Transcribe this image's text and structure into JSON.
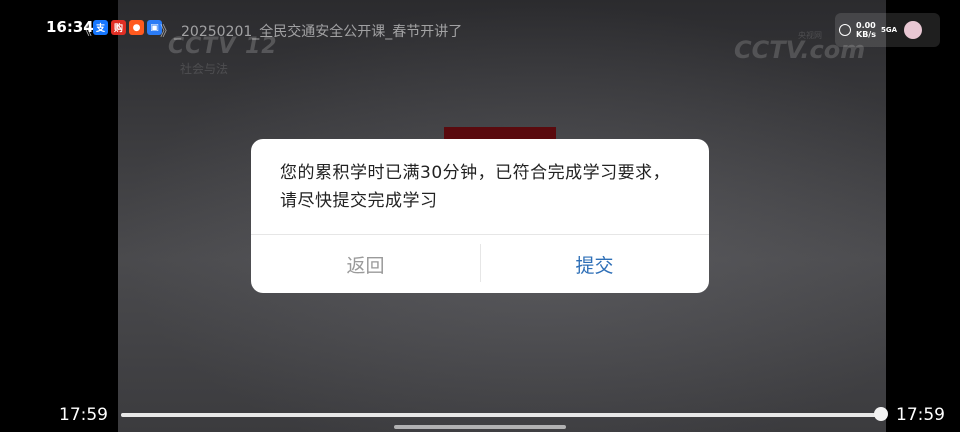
{
  "status_bar": {
    "time": "16:34",
    "notification_icons": [
      {
        "name": "alipay-icon",
        "glyph": "支",
        "color": "#1677ff"
      },
      {
        "name": "red-app-icon",
        "glyph": "购",
        "color": "#e02e24"
      },
      {
        "name": "orange-app-icon",
        "glyph": "●",
        "color": "#ff5a1f"
      },
      {
        "name": "blue-app-icon",
        "glyph": "▣",
        "color": "#2b7cf6"
      }
    ],
    "network_speed": "0.00",
    "network_unit": "KB/s",
    "network_type": "5GA"
  },
  "video": {
    "back_glyph": "《",
    "title": "》_20250201_全民交通安全公开课_春节开讲了",
    "watermark_left": "CCTV 12",
    "watermark_left_sub": "社会与法",
    "watermark_right": "CCTV.com",
    "watermark_right_small": "央视网"
  },
  "dialog": {
    "message": "您的累积学时已满30分钟，已符合完成学习要求，请尽快提交完成学习",
    "back_label": "返回",
    "submit_label": "提交",
    "submit_color": "#2e6fb7"
  },
  "player": {
    "current_time": "17:59",
    "total_time": "17:59",
    "progress": 1.0
  }
}
